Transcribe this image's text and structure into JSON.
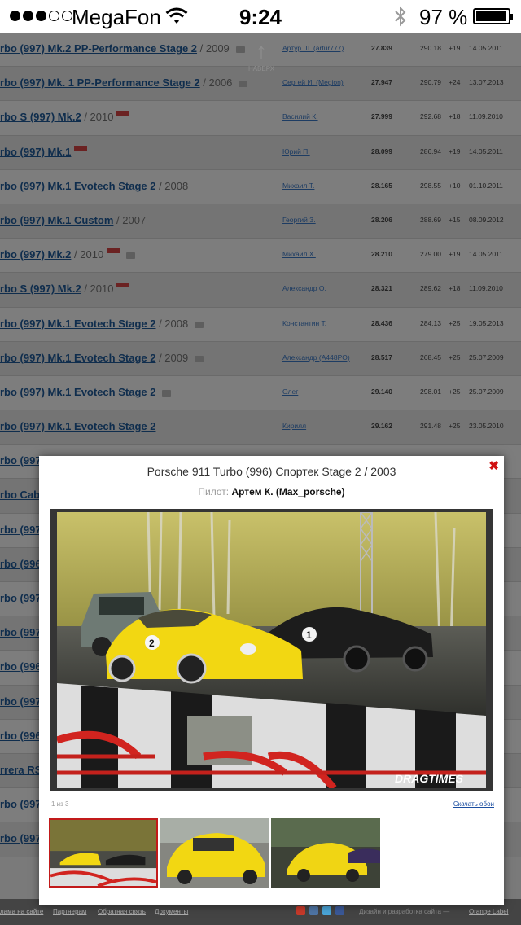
{
  "status_bar": {
    "carrier": "MegaFon",
    "time": "9:24",
    "battery": "97 %",
    "signal_bars_filled": 3,
    "signal_bars_total": 5
  },
  "scroll_top": {
    "label": "НАВЕРХ"
  },
  "rows": [
    {
      "car": "rbo (997) Mk.2 PP-Performance Stage 2",
      "year": " / 2009",
      "badge": false,
      "camera": true,
      "pilot": "Артур Ш. (artur777)",
      "time": "27.839",
      "speed": "290.18",
      "delta": "+19",
      "date": "14.05.2011"
    },
    {
      "car": "rbo (997) Mk. 1 PP-Performance Stage 2",
      "year": " / 2006",
      "badge": false,
      "camera": true,
      "pilot": "Сергей И. (Megion)",
      "time": "27.947",
      "speed": "290.79",
      "delta": "+24",
      "date": "13.07.2013"
    },
    {
      "car": "rbo S (997) Mk.2",
      "year": " / 2010",
      "badge": true,
      "camera": false,
      "pilot": "Василий К.",
      "time": "27.999",
      "speed": "292.68",
      "delta": "+18",
      "date": "11.09.2010"
    },
    {
      "car": "rbo (997) Mk.1",
      "year": "",
      "badge": true,
      "camera": false,
      "pilot": "Юрий П.",
      "time": "28.099",
      "speed": "286.94",
      "delta": "+19",
      "date": "14.05.2011"
    },
    {
      "car": "rbo (997) Mk.1 Evotech Stage 2",
      "year": " / 2008",
      "badge": false,
      "camera": false,
      "pilot": "Михаил Т.",
      "time": "28.165",
      "speed": "298.55",
      "delta": "+10",
      "date": "01.10.2011"
    },
    {
      "car": "rbo (997) Mk.1 Custom",
      "year": " / 2007",
      "badge": false,
      "camera": false,
      "pilot": "Георгий З.",
      "time": "28.206",
      "speed": "288.69",
      "delta": "+15",
      "date": "08.09.2012"
    },
    {
      "car": "rbo (997) Mk.2",
      "year": " / 2010",
      "badge": true,
      "camera": true,
      "pilot": "Михаил Х.",
      "time": "28.210",
      "speed": "279.00",
      "delta": "+19",
      "date": "14.05.2011"
    },
    {
      "car": "rbo S (997) Mk.2",
      "year": " / 2010",
      "badge": true,
      "camera": false,
      "pilot": "Александр О.",
      "time": "28.321",
      "speed": "289.62",
      "delta": "+18",
      "date": "11.09.2010"
    },
    {
      "car": "rbo (997) Mk.1 Evotech Stage 2",
      "year": " / 2008",
      "badge": false,
      "camera": true,
      "pilot": "Константин Т.",
      "time": "28.436",
      "speed": "284.13",
      "delta": "+25",
      "date": "19.05.2013"
    },
    {
      "car": "rbo (997) Mk.1 Evotech Stage 2",
      "year": " / 2009",
      "badge": false,
      "camera": true,
      "pilot": "Александр (A448PO)",
      "time": "28.517",
      "speed": "268.45",
      "delta": "+25",
      "date": "25.07.2009"
    },
    {
      "car": "rbo (997) Mk.1 Evotech Stage 2",
      "year": "",
      "badge": false,
      "camera": true,
      "pilot": "Олег",
      "time": "29.140",
      "speed": "298.01",
      "delta": "+25",
      "date": "25.07.2009"
    },
    {
      "car": "rbo (997) Mk.1 Evotech Stage 2",
      "year": "",
      "badge": false,
      "camera": false,
      "pilot": "Кирилл",
      "time": "29.162",
      "speed": "291.48",
      "delta": "+25",
      "date": "23.05.2010"
    },
    {
      "car": "rbo (997",
      "year": "",
      "badge": false,
      "camera": false,
      "pilot": "",
      "time": "",
      "speed": "",
      "delta": "",
      "date": ""
    },
    {
      "car": "rbo Cab",
      "year": "",
      "badge": false,
      "camera": false,
      "pilot": "",
      "time": "",
      "speed": "",
      "delta": "",
      "date": ""
    },
    {
      "car": "rbo (997",
      "year": "",
      "badge": false,
      "camera": false,
      "pilot": "",
      "time": "",
      "speed": "",
      "delta": "",
      "date": ""
    },
    {
      "car": "rbo (996",
      "year": "",
      "badge": false,
      "camera": false,
      "pilot": "",
      "time": "",
      "speed": "",
      "delta": "",
      "date": ""
    },
    {
      "car": "rbo (997",
      "year": "",
      "badge": false,
      "camera": false,
      "pilot": "",
      "time": "",
      "speed": "",
      "delta": "",
      "date": ""
    },
    {
      "car": "rbo (997",
      "year": "",
      "badge": false,
      "camera": false,
      "pilot": "",
      "time": "",
      "speed": "",
      "delta": "",
      "date": ""
    },
    {
      "car": "rbo (996",
      "year": "",
      "badge": false,
      "camera": false,
      "pilot": "",
      "time": "",
      "speed": "",
      "delta": "",
      "date": ""
    },
    {
      "car": "rbo (997",
      "year": "",
      "badge": false,
      "camera": false,
      "pilot": "",
      "time": "",
      "speed": "",
      "delta": "",
      "date": ""
    },
    {
      "car": "rbo (996",
      "year": "",
      "badge": false,
      "camera": false,
      "pilot": "",
      "time": "",
      "speed": "",
      "delta": "",
      "date": ""
    },
    {
      "car": "rrera RS",
      "year": "",
      "badge": false,
      "camera": false,
      "pilot": "",
      "time": "",
      "speed": "",
      "delta": "",
      "date": ""
    },
    {
      "car": "rbo (997",
      "year": "",
      "badge": false,
      "camera": false,
      "pilot": "",
      "time": "",
      "speed": "",
      "delta": "",
      "date": ""
    },
    {
      "car": "rbo (997",
      "year": "",
      "badge": false,
      "camera": false,
      "pilot": "",
      "time": "",
      "speed": "",
      "delta": "",
      "date": ""
    }
  ],
  "modal": {
    "title": "Porsche 911 Turbo (996) Спортек Stage 2 / 2003",
    "pilot_label": "Пилот:",
    "pilot_name": "Артем К. (Max_porsche)",
    "counter": "1 из 3",
    "download": "Скачать обои",
    "watermark": "DRAGTIMES",
    "close_icon": "close-icon"
  },
  "footer": {
    "links": [
      "лама на сайте",
      "Партнерам",
      "Обратная связь",
      "Документы"
    ],
    "credit": "Дизайн и разработка сайта —",
    "credit_link": "Orange Label",
    "social_icons": [
      "youtube-icon",
      "vk-icon",
      "twitter-icon",
      "facebook-icon"
    ],
    "social_colors": [
      "#c83a2a",
      "#4f75a5",
      "#4aa5d8",
      "#3b5998"
    ]
  },
  "colors": {
    "accent_red": "#d01111",
    "link_blue": "#1a4da0",
    "overlay_gray": "#7a7a7a"
  }
}
